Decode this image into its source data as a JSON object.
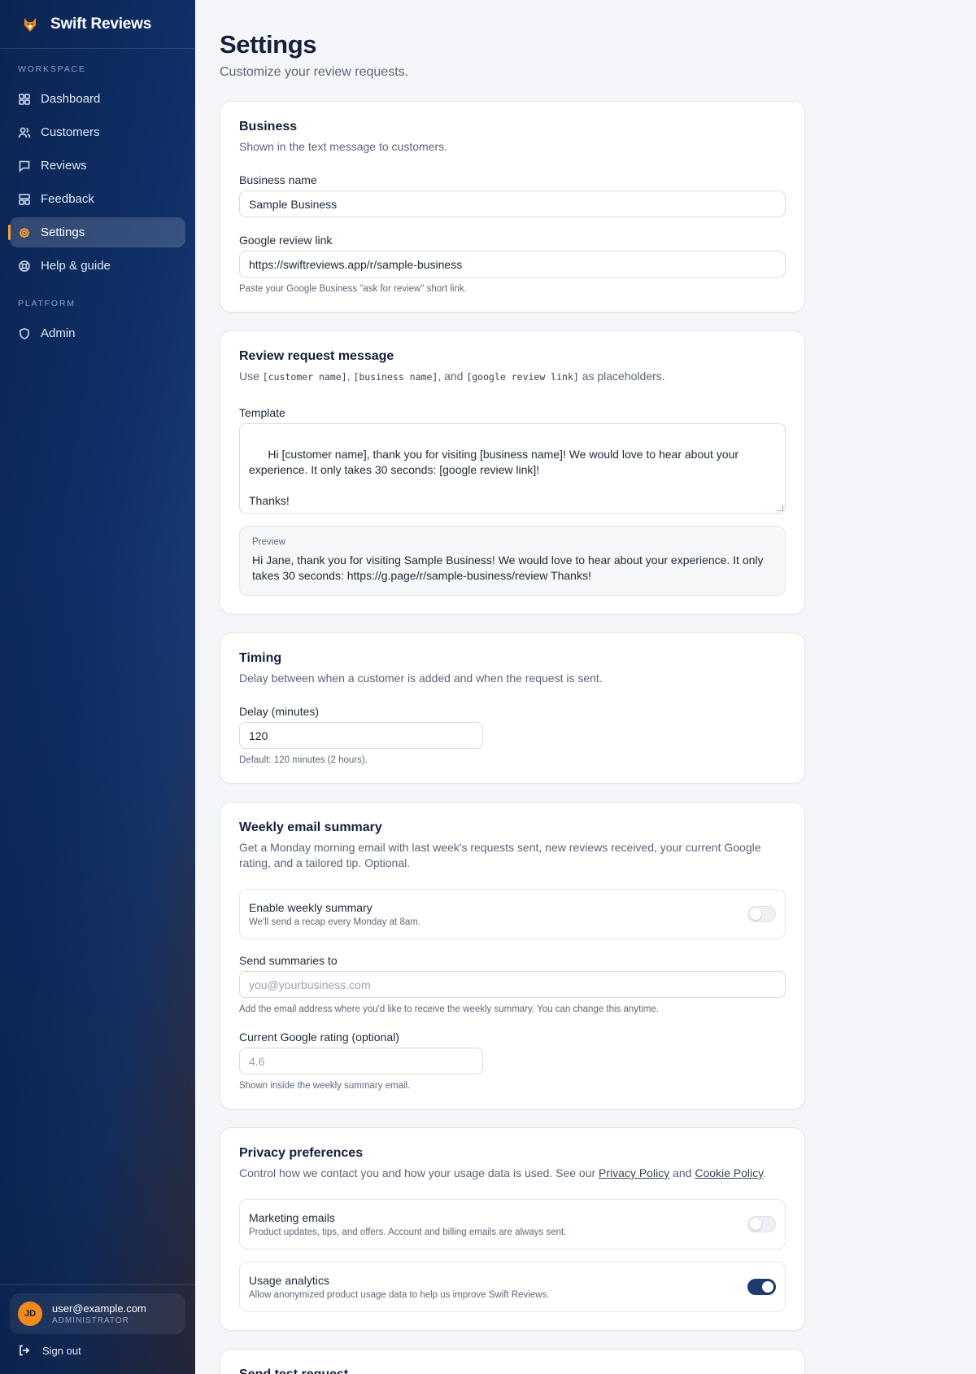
{
  "brand": {
    "name": "Swift Reviews"
  },
  "sidebar": {
    "workspace_label": "WORKSPACE",
    "items": [
      {
        "label": "Dashboard",
        "icon": "grid-icon"
      },
      {
        "label": "Customers",
        "icon": "users-icon"
      },
      {
        "label": "Reviews",
        "icon": "message-square-icon"
      },
      {
        "label": "Feedback",
        "icon": "layout-icon"
      },
      {
        "label": "Settings",
        "icon": "gear-icon",
        "active": true
      },
      {
        "label": "Help & guide",
        "icon": "lifebuoy-icon"
      }
    ],
    "platform_label": "PLATFORM",
    "platform_items": [
      {
        "label": "Admin",
        "icon": "shield-icon"
      }
    ],
    "user": {
      "initials": "JD",
      "email": "user@example.com",
      "role": "ADMINISTRATOR"
    },
    "signout_label": "Sign out"
  },
  "page": {
    "title": "Settings",
    "subtitle": "Customize your review requests."
  },
  "business": {
    "title": "Business",
    "desc": "Shown in the text message to customers.",
    "name_label": "Business name",
    "name_value": "Sample Business",
    "link_label": "Google review link",
    "link_value": "https://swiftreviews.app/r/sample-business",
    "link_hint": "Paste your Google Business \"ask for review\" short link."
  },
  "message": {
    "title": "Review request message",
    "desc_prefix": "Use ",
    "ph1": "[customer name]",
    "sep1": ", ",
    "ph2": "[business name]",
    "sep2": ", and ",
    "ph3": "[google review link]",
    "desc_suffix": " as placeholders.",
    "template_label": "Template",
    "template_value": "Hi [customer name], thank you for visiting [business name]! We would love to hear about your experience. It only takes 30 seconds: [google review link]!\n\nThanks!",
    "preview_label": "Preview",
    "preview_text": "Hi Jane, thank you for visiting Sample Business! We would love to hear about your experience. It only takes 30 seconds: https://g.page/r/sample-business/review Thanks!"
  },
  "timing": {
    "title": "Timing",
    "desc": "Delay between when a customer is added and when the request is sent.",
    "delay_label": "Delay (minutes)",
    "delay_value": "120",
    "delay_hint": "Default: 120 minutes (2 hours)."
  },
  "weekly": {
    "title": "Weekly email summary",
    "desc": "Get a Monday morning email with last week's requests sent, new reviews received, your current Google rating, and a tailored tip. Optional.",
    "enable_title": "Enable weekly summary",
    "enable_sub": "We'll send a recap every Monday at 8am.",
    "enable_on": false,
    "send_to_label": "Send summaries to",
    "send_to_placeholder": "you@yourbusiness.com",
    "send_to_hint": "Add the email address where you'd like to receive the weekly summary. You can change this anytime.",
    "rating_label": "Current Google rating (optional)",
    "rating_placeholder": "4.6",
    "rating_hint": "Shown inside the weekly summary email."
  },
  "privacy": {
    "title": "Privacy preferences",
    "desc_prefix": "Control how we contact you and how your usage data is used. See our ",
    "privacy_link": "Privacy Policy",
    "desc_mid": " and ",
    "cookie_link": "Cookie Policy",
    "desc_suffix": ".",
    "marketing_title": "Marketing emails",
    "marketing_sub": "Product updates, tips, and offers. Account and billing emails are always sent.",
    "marketing_on": false,
    "analytics_title": "Usage analytics",
    "analytics_sub": "Allow anonymized product usage data to help us improve Swift Reviews.",
    "analytics_on": true
  },
  "test": {
    "title": "Send test request"
  },
  "colors": {
    "accent": "#f59e3b",
    "toggle_on": "#1e3d6e",
    "sidebar_dark": "#0b2452"
  }
}
